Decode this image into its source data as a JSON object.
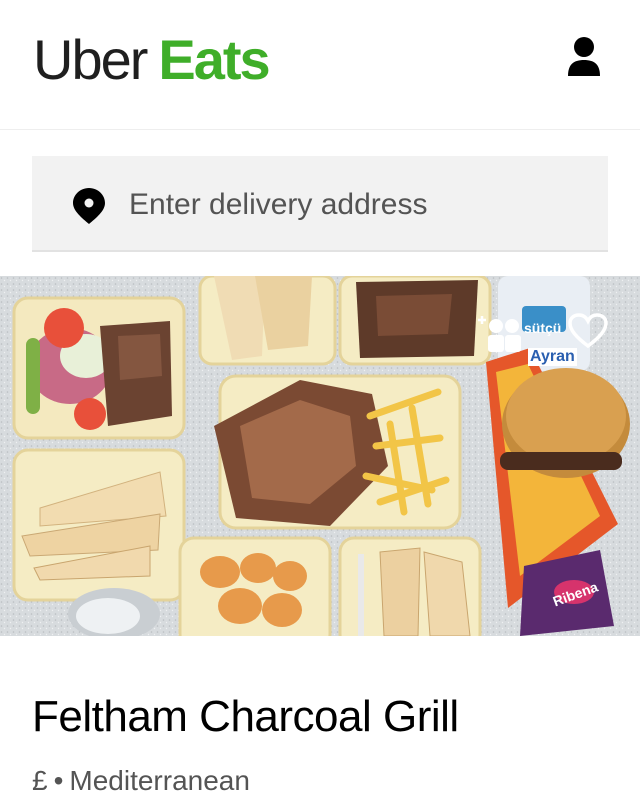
{
  "header": {
    "brand_first": "Uber",
    "brand_second": "Eats",
    "brand_colors": {
      "uber": "#1f1f1f",
      "eats": "#3fae29"
    },
    "account_icon": "person-icon"
  },
  "search": {
    "placeholder": "Enter delivery address",
    "icon": "location-pin-icon"
  },
  "hero": {
    "image_alt": "",
    "packaging_text": "Ayran",
    "packaging_text_2": "sütçü",
    "can_text": "Ribena",
    "actions": {
      "group_order_icon": "group-order-icon",
      "favorite_icon": "heart-icon"
    }
  },
  "restaurant": {
    "name": "Feltham Charcoal Grill",
    "price": "£",
    "separator": "•",
    "cuisine": "Mediterranean"
  }
}
